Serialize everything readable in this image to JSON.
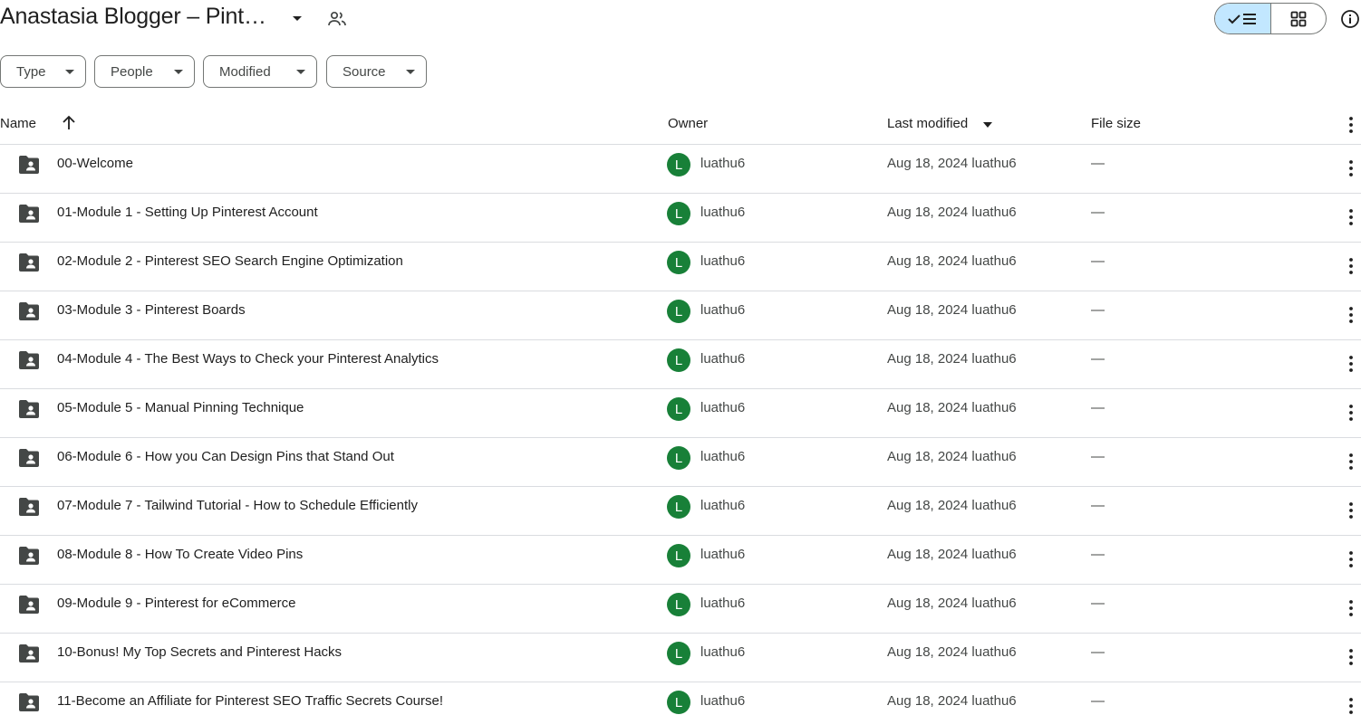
{
  "header": {
    "title": "Anastasia Blogger – Pint…",
    "title_caret_icon": "caret-down-icon",
    "shared_icon": "people-icon",
    "view_toggle": {
      "list_icon": "check-list-icon",
      "grid_icon": "grid-icon",
      "active": "list"
    },
    "info_icon": "info-icon"
  },
  "filters": [
    {
      "label": "Type"
    },
    {
      "label": "People"
    },
    {
      "label": "Modified"
    },
    {
      "label": "Source"
    }
  ],
  "columns": {
    "name": "Name",
    "owner": "Owner",
    "last_modified": "Last modified",
    "file_size": "File size"
  },
  "rows": [
    {
      "name": "00-Welcome",
      "avatar": "L",
      "owner": "luathu6",
      "modified": "Aug 18, 2024 luathu6",
      "size": "—"
    },
    {
      "name": "01-Module 1 - Setting Up Pinterest Account",
      "avatar": "L",
      "owner": "luathu6",
      "modified": "Aug 18, 2024 luathu6",
      "size": "—"
    },
    {
      "name": "02-Module 2 - Pinterest SEO Search Engine Optimization",
      "avatar": "L",
      "owner": "luathu6",
      "modified": "Aug 18, 2024 luathu6",
      "size": "—"
    },
    {
      "name": "03-Module 3 - Pinterest Boards",
      "avatar": "L",
      "owner": "luathu6",
      "modified": "Aug 18, 2024 luathu6",
      "size": "—"
    },
    {
      "name": "04-Module 4 - The Best Ways to Check your Pinterest Analytics",
      "avatar": "L",
      "owner": "luathu6",
      "modified": "Aug 18, 2024 luathu6",
      "size": "—"
    },
    {
      "name": "05-Module 5 - Manual Pinning Technique",
      "avatar": "L",
      "owner": "luathu6",
      "modified": "Aug 18, 2024 luathu6",
      "size": "—"
    },
    {
      "name": "06-Module 6 - How you Can Design Pins that Stand Out",
      "avatar": "L",
      "owner": "luathu6",
      "modified": "Aug 18, 2024 luathu6",
      "size": "—"
    },
    {
      "name": "07-Module 7 - Tailwind Tutorial - How to Schedule Efficiently",
      "avatar": "L",
      "owner": "luathu6",
      "modified": "Aug 18, 2024 luathu6",
      "size": "—"
    },
    {
      "name": "08-Module 8 - How To Create Video Pins",
      "avatar": "L",
      "owner": "luathu6",
      "modified": "Aug 18, 2024 luathu6",
      "size": "—"
    },
    {
      "name": "09-Module 9 - Pinterest for eCommerce",
      "avatar": "L",
      "owner": "luathu6",
      "modified": "Aug 18, 2024 luathu6",
      "size": "—"
    },
    {
      "name": "10-Bonus! My Top Secrets and Pinterest Hacks",
      "avatar": "L",
      "owner": "luathu6",
      "modified": "Aug 18, 2024 luathu6",
      "size": "—"
    },
    {
      "name": "11-Become an Affiliate for Pinterest SEO Traffic Secrets Course!",
      "avatar": "L",
      "owner": "luathu6",
      "modified": "Aug 18, 2024 luathu6",
      "size": "—"
    }
  ],
  "colors": {
    "text": "#1f1f1f",
    "secondary_text": "#444746",
    "border": "#747775",
    "divider": "#dadce0",
    "toggle_active_bg": "#c2e7ff",
    "avatar_bg": "#188038"
  }
}
